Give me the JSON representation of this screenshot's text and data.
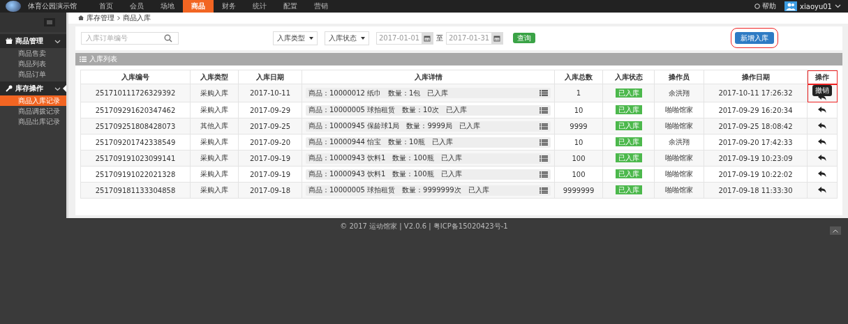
{
  "brand": {
    "name": "体育公园演示馆"
  },
  "nav": [
    {
      "label": "首页",
      "selected": false
    },
    {
      "label": "会员",
      "selected": false
    },
    {
      "label": "场地",
      "selected": false
    },
    {
      "label": "商品",
      "selected": true
    },
    {
      "label": "财务",
      "selected": false
    },
    {
      "label": "统计",
      "selected": false
    },
    {
      "label": "配置",
      "selected": false
    },
    {
      "label": "营销",
      "selected": false
    }
  ],
  "help": "帮助",
  "user": "xiaoyu01",
  "sidebar": {
    "groups": [
      {
        "label": "商品管理",
        "expanded": true,
        "items": [
          {
            "label": "商品售卖",
            "selected": false
          },
          {
            "label": "商品列表",
            "selected": false
          },
          {
            "label": "商品订单",
            "selected": false
          }
        ]
      },
      {
        "label": "库存操作",
        "expanded": true,
        "items": [
          {
            "label": "商品入库记录",
            "selected": true
          },
          {
            "label": "商品调拨记录",
            "selected": false
          },
          {
            "label": "商品出库记录",
            "selected": false
          }
        ]
      }
    ]
  },
  "breadcrumb": [
    "库存管理",
    "商品入库"
  ],
  "filters": {
    "search_placeholder": "入库订单编号",
    "type_select": "入库类型",
    "status_select": "入库状态",
    "date_from": "2017-01-01",
    "date_sep": "至",
    "date_to": "2017-01-31",
    "query": "查询",
    "new": "新增入库"
  },
  "panel_title": "入库列表",
  "table": {
    "columns": [
      "入库编号",
      "入库类型",
      "入库日期",
      "入库详情",
      "入库总数",
      "入库状态",
      "操作员",
      "操作日期",
      "操作"
    ],
    "rows": [
      {
        "id": "251710111726329392",
        "type": "采购入库",
        "date": "2017-10-11",
        "detail": "商品：10000012 纸巾　数量：1包　已入库",
        "total": "1",
        "status": "已入库",
        "operator": "余洪翔",
        "time": "2017-10-11 17:26:32"
      },
      {
        "id": "251709291620347462",
        "type": "采购入库",
        "date": "2017-09-29",
        "detail": "商品：10000005 球拍租赁　数量：10次　已入库",
        "total": "10",
        "status": "已入库",
        "operator": "啪啪馆家",
        "time": "2017-09-29 16:20:34"
      },
      {
        "id": "251709251808428073",
        "type": "其他入库",
        "date": "2017-09-25",
        "detail": "商品：10000945 保龄球1局　数量：9999局　已入库",
        "total": "9999",
        "status": "已入库",
        "operator": "啪啪馆家",
        "time": "2017-09-25 18:08:42"
      },
      {
        "id": "251709201742338549",
        "type": "采购入库",
        "date": "2017-09-20",
        "detail": "商品：10000944 怡宝　数量：10瓶　已入库",
        "total": "10",
        "status": "已入库",
        "operator": "余洪翔",
        "time": "2017-09-20 17:42:33"
      },
      {
        "id": "251709191023099141",
        "type": "采购入库",
        "date": "2017-09-19",
        "detail": "商品：10000943 饮料1　数量：100瓶　已入库",
        "total": "100",
        "status": "已入库",
        "operator": "啪啪馆家",
        "time": "2017-09-19 10:23:09"
      },
      {
        "id": "251709191022021328",
        "type": "采购入库",
        "date": "2017-09-19",
        "detail": "商品：10000943 饮料1　数量：100瓶　已入库",
        "total": "100",
        "status": "已入库",
        "operator": "啪啪馆家",
        "time": "2017-09-19 10:22:02"
      },
      {
        "id": "251709181133304858",
        "type": "采购入库",
        "date": "2017-09-18",
        "detail": "商品：10000005 球拍租赁　数量：9999999次　已入库",
        "total": "9999999",
        "status": "已入库",
        "operator": "啪啪馆家",
        "time": "2017-09-18 11:33:30"
      }
    ]
  },
  "tooltip": "撤销",
  "footer": "© 2017 运动馆家 | V2.0.6 | 粤ICP备15020423号-1"
}
